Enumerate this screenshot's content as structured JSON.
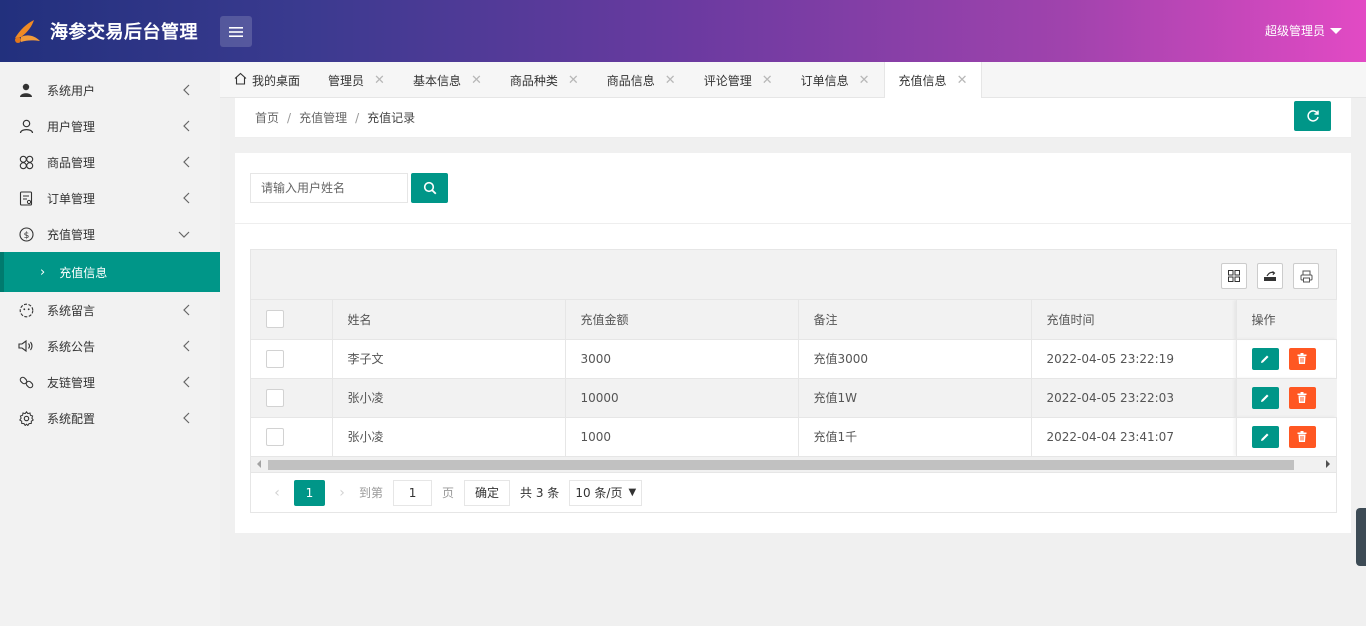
{
  "header": {
    "title": "海参交易后台管理",
    "user_label": "超级管理员",
    "logo_color": "#f08a24",
    "menu_icon": "hamburger-icon"
  },
  "sidebar": {
    "items": [
      {
        "label": "系统用户",
        "icon": "user-filled-icon"
      },
      {
        "label": "用户管理",
        "icon": "user-outline-icon"
      },
      {
        "label": "商品管理",
        "icon": "clover-icon"
      },
      {
        "label": "订单管理",
        "icon": "receipt-icon"
      },
      {
        "label": "充值管理",
        "icon": "dollar-circle-icon",
        "expanded": true
      },
      {
        "label": "系统留言",
        "icon": "smile-icon"
      },
      {
        "label": "系统公告",
        "icon": "speaker-icon"
      },
      {
        "label": "友链管理",
        "icon": "link-icon"
      },
      {
        "label": "系统配置",
        "icon": "gear-icon"
      }
    ],
    "sub_active": "充值信息",
    "accent": "#009688"
  },
  "tabs": {
    "home": "我的桌面",
    "items": [
      "管理员",
      "基本信息",
      "商品种类",
      "商品信息",
      "评论管理",
      "订单信息",
      "充值信息"
    ],
    "close_glyph": "✕",
    "active": "充值信息"
  },
  "breadcrumb": {
    "items": [
      "首页",
      "充值管理",
      "充值记录"
    ],
    "separator": "/"
  },
  "search": {
    "placeholder": "请输入用户姓名"
  },
  "table": {
    "columns": [
      "姓名",
      "充值金额",
      "备注",
      "充值时间",
      "操作"
    ],
    "rows": [
      {
        "name": "李子文",
        "amount": "3000",
        "note": "充值3000",
        "time": "2022-04-05 23:22:19"
      },
      {
        "name": "张小凌",
        "amount": "10000",
        "note": "充值1W",
        "time": "2022-04-05 23:22:03"
      },
      {
        "name": "张小凌",
        "amount": "1000",
        "note": "充值1千",
        "time": "2022-04-04 23:41:07"
      }
    ],
    "edit_color": "#009688",
    "delete_color": "#ff5722"
  },
  "pager": {
    "current": "1",
    "goto_label": "到第",
    "goto_value": "1",
    "page_unit": "页",
    "confirm": "确定",
    "total": "共 3 条",
    "page_size": "10 条/页"
  }
}
